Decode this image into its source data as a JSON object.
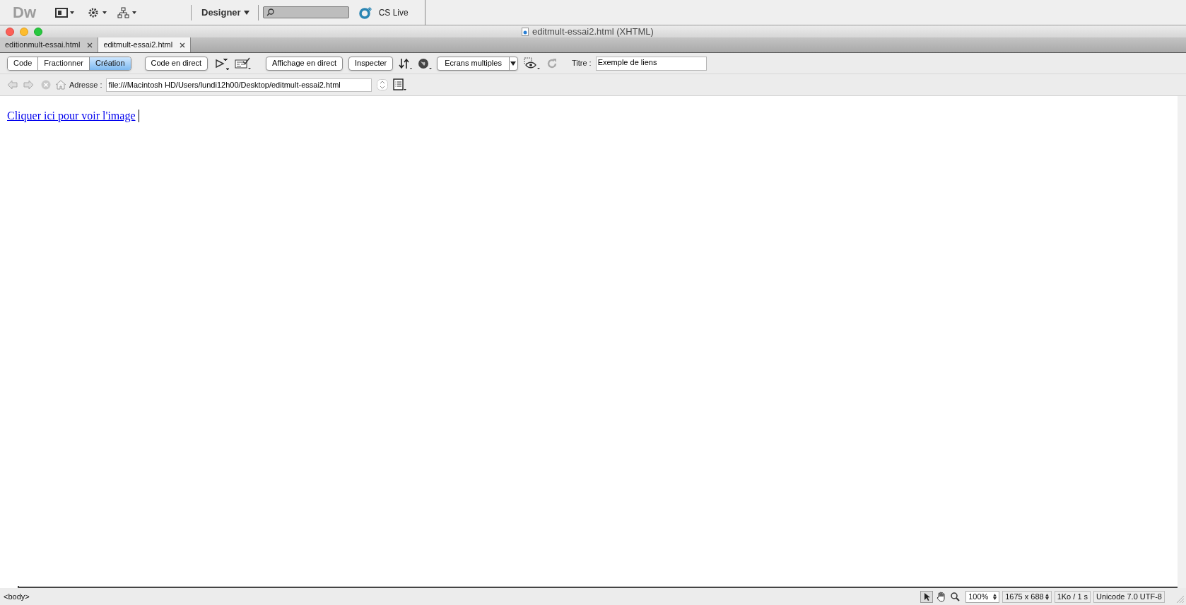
{
  "app_bar": {
    "logo": "Dw",
    "workspace": "Designer",
    "cs_live": "CS Live"
  },
  "window": {
    "title": "editmult-essai2.html (XHTML)"
  },
  "tabs": [
    {
      "label": "editionmult-essai.html",
      "selected": false
    },
    {
      "label": "editmult-essai2.html",
      "selected": true
    }
  ],
  "view_buttons": [
    {
      "label": "Code",
      "selected": false
    },
    {
      "label": "Fractionner",
      "selected": false
    },
    {
      "label": "Création",
      "selected": true
    }
  ],
  "toolbar": {
    "live_code": "Code en direct",
    "live_view": "Affichage en direct",
    "inspect": "Inspecter",
    "multiscreen": "Ecrans multiples",
    "title_label": "Titre :",
    "title_value": "Exemple de liens"
  },
  "address_bar": {
    "label": "Adresse :",
    "value": "file:///Macintosh HD/Users/lundi12h00/Desktop/editmult-essai2.html"
  },
  "document": {
    "link": "Cliquer ici pour voir l'image"
  },
  "status_bar": {
    "tag": "<body>",
    "zoom": "100%",
    "window_size": "1675 x 688",
    "download": "1Ko / 1 s",
    "encoding": "Unicode 7.0 UTF-8"
  }
}
